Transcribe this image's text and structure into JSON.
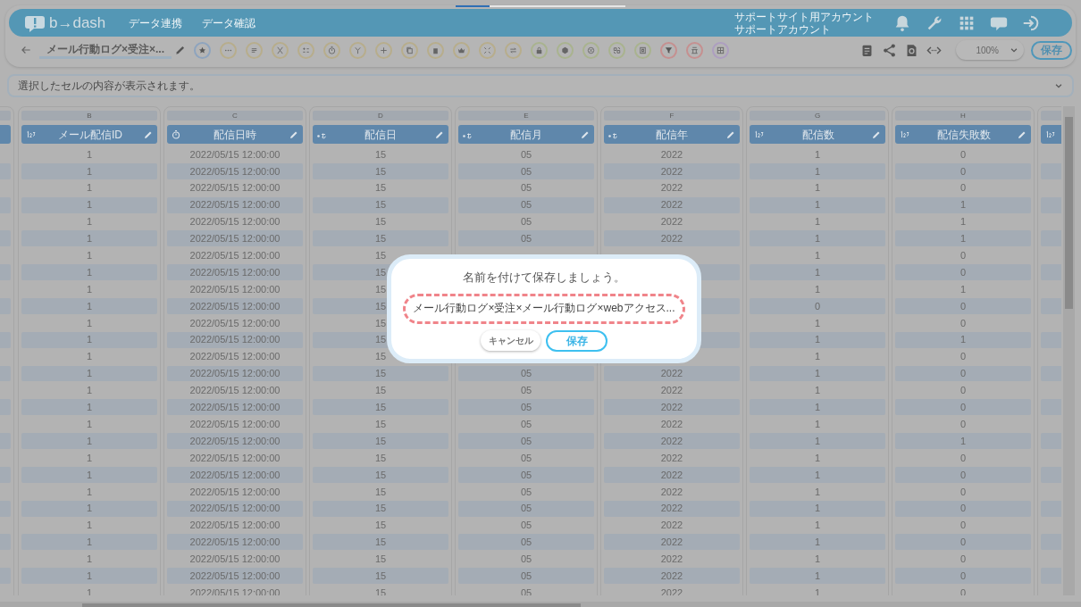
{
  "nav": {
    "logo": "b→dash",
    "links": [
      "データ連携",
      "データ確認"
    ],
    "account": [
      "サポートサイト用アカウント",
      "サポートアカウント"
    ]
  },
  "toolbar": {
    "title": "メール行動ログ×受注×...",
    "zoom": "100%",
    "save": "保存"
  },
  "formula_bar": {
    "placeholder": "選択したセルの内容が表示されます。"
  },
  "table": {
    "columns": [
      {
        "letter": "B",
        "title": "メール配信ID",
        "kind": "number"
      },
      {
        "letter": "C",
        "title": "配信日時",
        "kind": "datetime"
      },
      {
        "letter": "D",
        "title": "配信日",
        "kind": "text"
      },
      {
        "letter": "E",
        "title": "配信月",
        "kind": "text"
      },
      {
        "letter": "F",
        "title": "配信年",
        "kind": "text"
      },
      {
        "letter": "G",
        "title": "配信数",
        "kind": "number"
      },
      {
        "letter": "H",
        "title": "配信失敗数",
        "kind": "number"
      }
    ],
    "partial_right_column": {
      "kind": "number"
    },
    "rows": [
      [
        "1",
        "2022/05/15 12:00:00",
        "15",
        "05",
        "2022",
        "1",
        "0"
      ],
      [
        "1",
        "2022/05/15 12:00:00",
        "15",
        "05",
        "2022",
        "1",
        "0"
      ],
      [
        "1",
        "2022/05/15 12:00:00",
        "15",
        "05",
        "2022",
        "1",
        "0"
      ],
      [
        "1",
        "2022/05/15 12:00:00",
        "15",
        "05",
        "2022",
        "1",
        "1"
      ],
      [
        "1",
        "2022/05/15 12:00:00",
        "15",
        "05",
        "2022",
        "1",
        "1"
      ],
      [
        "1",
        "2022/05/15 12:00:00",
        "15",
        "05",
        "2022",
        "1",
        "1"
      ],
      [
        "1",
        "2022/05/15 12:00:00",
        "15",
        null,
        null,
        "1",
        "0"
      ],
      [
        "1",
        "2022/05/15 12:00:00",
        "15",
        null,
        null,
        "1",
        "0"
      ],
      [
        "1",
        "2022/05/15 12:00:00",
        "15",
        null,
        null,
        "1",
        "1"
      ],
      [
        "1",
        "2022/05/15 12:00:00",
        "15",
        null,
        null,
        "0",
        "0"
      ],
      [
        "1",
        "2022/05/15 12:00:00",
        "15",
        null,
        null,
        "1",
        "0"
      ],
      [
        "1",
        "2022/05/15 12:00:00",
        "15",
        null,
        null,
        "1",
        "1"
      ],
      [
        "1",
        "2022/05/15 12:00:00",
        "15",
        null,
        null,
        "1",
        "0"
      ],
      [
        "1",
        "2022/05/15 12:00:00",
        "15",
        "05",
        "2022",
        "1",
        "0"
      ],
      [
        "1",
        "2022/05/15 12:00:00",
        "15",
        "05",
        "2022",
        "1",
        "0"
      ],
      [
        "1",
        "2022/05/15 12:00:00",
        "15",
        "05",
        "2022",
        "1",
        "0"
      ],
      [
        "1",
        "2022/05/15 12:00:00",
        "15",
        "05",
        "2022",
        "1",
        "0"
      ],
      [
        "1",
        "2022/05/15 12:00:00",
        "15",
        "05",
        "2022",
        "1",
        "1"
      ],
      [
        "1",
        "2022/05/15 12:00:00",
        "15",
        "05",
        "2022",
        "1",
        "0"
      ],
      [
        "1",
        "2022/05/15 12:00:00",
        "15",
        "05",
        "2022",
        "1",
        "0"
      ],
      [
        "1",
        "2022/05/15 12:00:00",
        "15",
        "05",
        "2022",
        "1",
        "0"
      ],
      [
        "1",
        "2022/05/15 12:00:00",
        "15",
        "05",
        "2022",
        "1",
        "0"
      ],
      [
        "1",
        "2022/05/15 12:00:00",
        "15",
        "05",
        "2022",
        "1",
        "0"
      ],
      [
        "1",
        "2022/05/15 12:00:00",
        "15",
        "05",
        "2022",
        "1",
        "0"
      ],
      [
        "1",
        "2022/05/15 12:00:00",
        "15",
        "05",
        "2022",
        "1",
        "0"
      ],
      [
        "1",
        "2022/05/15 12:00:00",
        "15",
        "05",
        "2022",
        "1",
        "0"
      ],
      [
        "1",
        "2022/05/15 12:00:00",
        "15",
        "05",
        "2022",
        "1",
        "0"
      ]
    ]
  },
  "dialog": {
    "title": "名前を付けて保存しましょう。",
    "name_value": "メール行動ログ×受注×メール行動ログ×webアクセス...",
    "buttons": [
      {
        "label": "キャンセル",
        "kind": "cancel"
      },
      {
        "label": "保存",
        "kind": "primary"
      }
    ]
  }
}
